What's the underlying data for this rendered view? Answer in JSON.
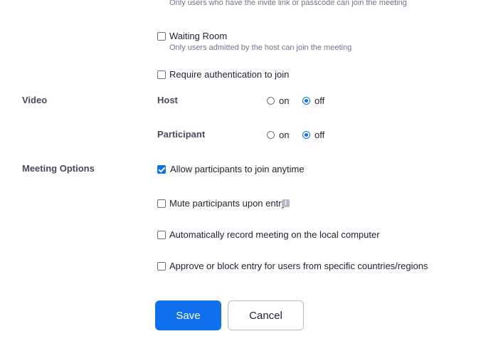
{
  "security": {
    "passcode_hint": "Only users who have the invite link or passcode can join the meeting",
    "waiting_room": {
      "label": "Waiting Room",
      "hint": "Only users admitted by the host can join the meeting",
      "checked": false
    },
    "require_auth": {
      "label": "Require authentication to join",
      "checked": false
    }
  },
  "video": {
    "section_label": "Video",
    "host": {
      "label": "Host",
      "on_label": "on",
      "off_label": "off",
      "value": "off"
    },
    "participant": {
      "label": "Participant",
      "on_label": "on",
      "off_label": "off",
      "value": "off"
    }
  },
  "meeting_options": {
    "section_label": "Meeting Options",
    "allow_join_anytime": {
      "label": "Allow participants to join anytime",
      "checked": true
    },
    "mute_on_entry": {
      "label": "Mute participants upon entry",
      "checked": false,
      "info_icon": "info-icon"
    },
    "auto_record": {
      "label": "Automatically record meeting on the local computer",
      "checked": false
    },
    "approve_block_regions": {
      "label": "Approve or block entry for users from specific countries/regions",
      "checked": false
    }
  },
  "actions": {
    "save_label": "Save",
    "cancel_label": "Cancel"
  },
  "colors": {
    "accent": "#0e71eb",
    "text": "#232333",
    "muted": "#747487"
  }
}
